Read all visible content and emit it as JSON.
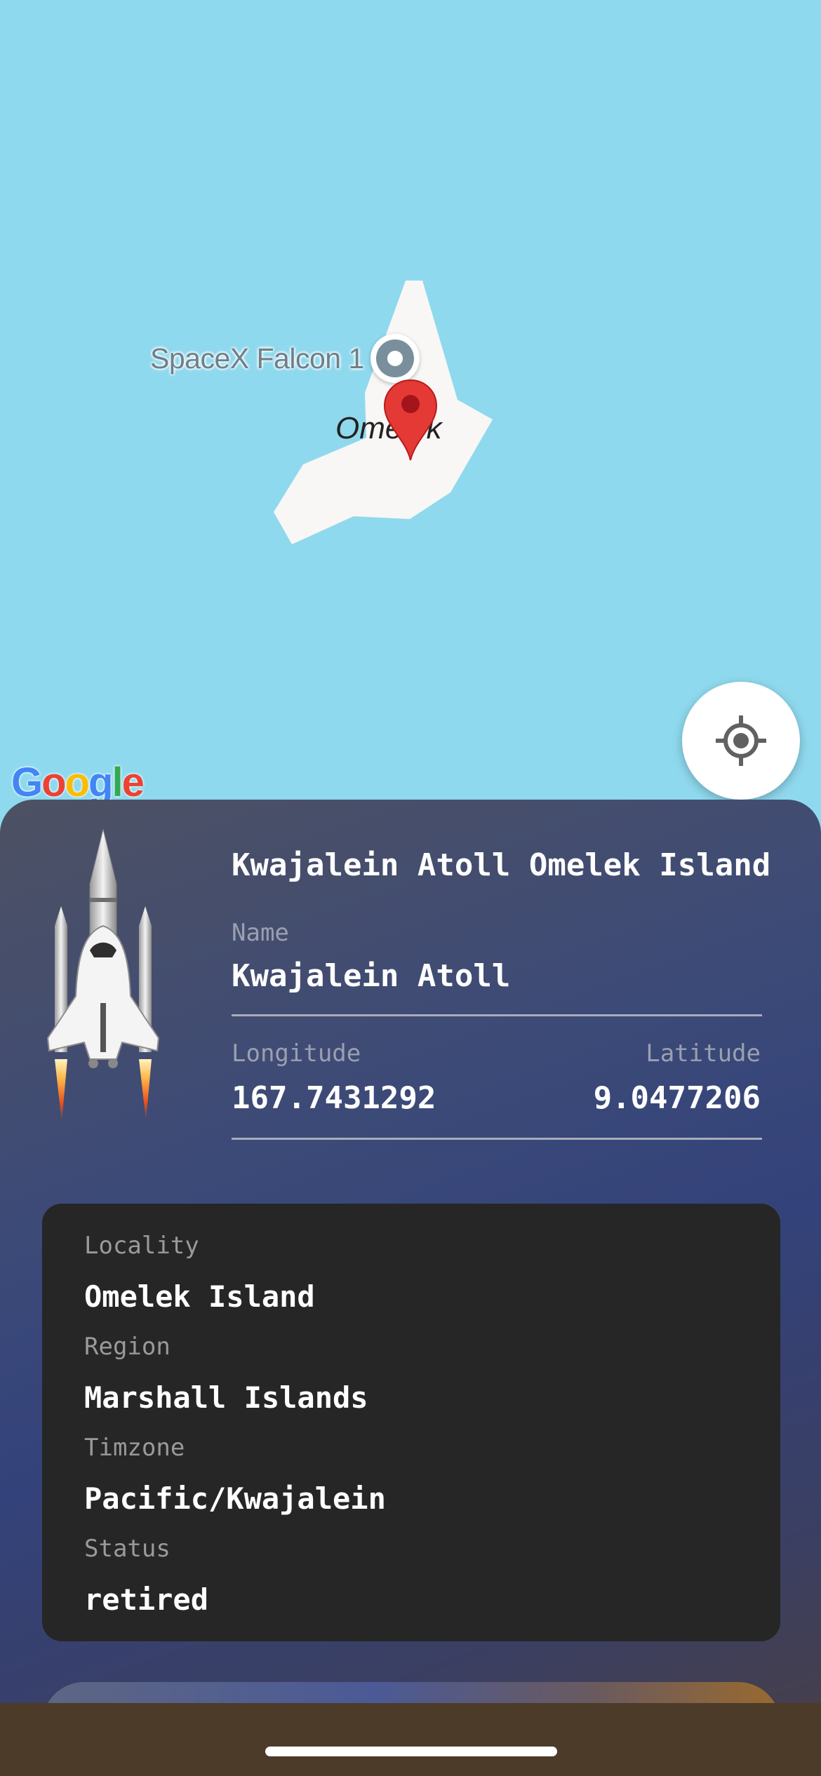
{
  "map": {
    "poi_label": "SpaceX Falcon 1",
    "place_label": "Omelek",
    "google_logo": {
      "g1": "G",
      "o1": "o",
      "o2": "o",
      "g2": "g",
      "l": "l",
      "e": "e"
    },
    "colors": {
      "water": "#8fd9ee",
      "land": "#f8f7f5",
      "pin": "#e53935"
    }
  },
  "site": {
    "title": "Kwajalein Atoll Omelek Island",
    "name_label": "Name",
    "name_value": "Kwajalein Atoll",
    "longitude_label": "Longitude",
    "longitude_value": "167.7431292",
    "latitude_label": "Latitude",
    "latitude_value": "9.0477206"
  },
  "details": {
    "locality_label": "Locality",
    "locality_value": "Omelek Island",
    "region_label": "Region",
    "region_value": "Marshall Islands",
    "timezone_label": "Timzone",
    "timezone_value": "Pacific/Kwajalein",
    "status_label": "Status",
    "status_value": "retired"
  },
  "icons": {
    "locate": "my-location-icon",
    "rocket": "space-shuttle-icon",
    "marker": "map-pin-icon"
  }
}
